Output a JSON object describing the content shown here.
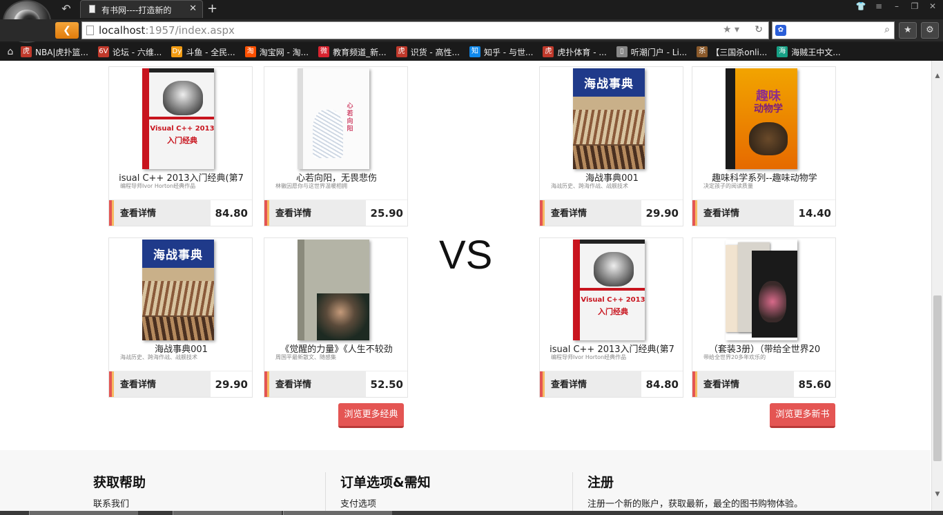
{
  "browser": {
    "tab_title": "有书网----打造新的",
    "url_host": "localhost",
    "url_rest": ":1957/index.aspx",
    "bookmarks": [
      {
        "label": "NBA|虎扑篮...",
        "icon": "虎",
        "color": "#c0392b"
      },
      {
        "label": "论坛 - 六维...",
        "icon": "6V",
        "color": "#c0392b"
      },
      {
        "label": "斗鱼 - 全民...",
        "icon": "Dy",
        "color": "#f39c12"
      },
      {
        "label": "淘宝网 - 淘...",
        "icon": "淘",
        "color": "#ff5000"
      },
      {
        "label": "教育频道_新...",
        "icon": "微",
        "color": "#d9232f"
      },
      {
        "label": "识货 - 高性...",
        "icon": "虎",
        "color": "#c0392b"
      },
      {
        "label": "知乎 - 与世...",
        "icon": "知",
        "color": "#0f88eb"
      },
      {
        "label": "虎扑体育 - ...",
        "icon": "虎",
        "color": "#c0392b"
      },
      {
        "label": "听潮门户 - Li...",
        "icon": "▯",
        "color": "#888888"
      },
      {
        "label": "【三国杀onli...",
        "icon": "杀",
        "color": "#8b5a2b"
      },
      {
        "label": "海贼王中文...",
        "icon": "海",
        "color": "#16a085"
      }
    ]
  },
  "left_books": [
    {
      "name": "isual C++ 2013入门经典(第7",
      "desc": "编程导师Ivor Horton经典作品",
      "detail": "查看详情",
      "price": "84.80",
      "cover": "vc"
    },
    {
      "name": "心若向阳，无畏悲伤",
      "desc": "林徽因愿你与这世界温暖相拥",
      "detail": "查看详情",
      "price": "25.90",
      "cover": "xin"
    },
    {
      "name": "海战事典001",
      "desc": "海战历史、跨海作战、战舰技术",
      "detail": "查看详情",
      "price": "29.90",
      "cover": "hai"
    },
    {
      "name": "《觉醒的力量》《人生不较劲",
      "desc": "周国平最新散文、随感集",
      "detail": "查看详情",
      "price": "52.50",
      "cover": "jue"
    }
  ],
  "right_books": [
    {
      "name": "海战事典001",
      "desc": "海战历史、跨海作战、战舰技术",
      "detail": "查看详情",
      "price": "29.90",
      "cover": "hai"
    },
    {
      "name": "趣味科学系列--趣味动物学",
      "desc": "决定孩子的阅读质量",
      "detail": "查看详情",
      "price": "14.40",
      "cover": "qu"
    },
    {
      "name": "isual C++ 2013入门经典(第7",
      "desc": "编程导师Ivor Horton经典作品",
      "detail": "查看详情",
      "price": "84.80",
      "cover": "vc"
    },
    {
      "name": "（套装3册）（带给全世界20",
      "desc": "带给全世界20多年欢乐的",
      "detail": "查看详情",
      "price": "85.60",
      "cover": "tao"
    }
  ],
  "vs_label": "VS",
  "more_classic": "浏览更多经典",
  "more_new": "浏览更多新书",
  "footer": {
    "help_title": "获取帮助",
    "help_item": "联系我们",
    "order_title": "订单选项&需知",
    "order_item": "支付选项",
    "register_title": "注册",
    "register_text": "注册一个新的账户，获取最新，最全的图书购物体验。"
  }
}
